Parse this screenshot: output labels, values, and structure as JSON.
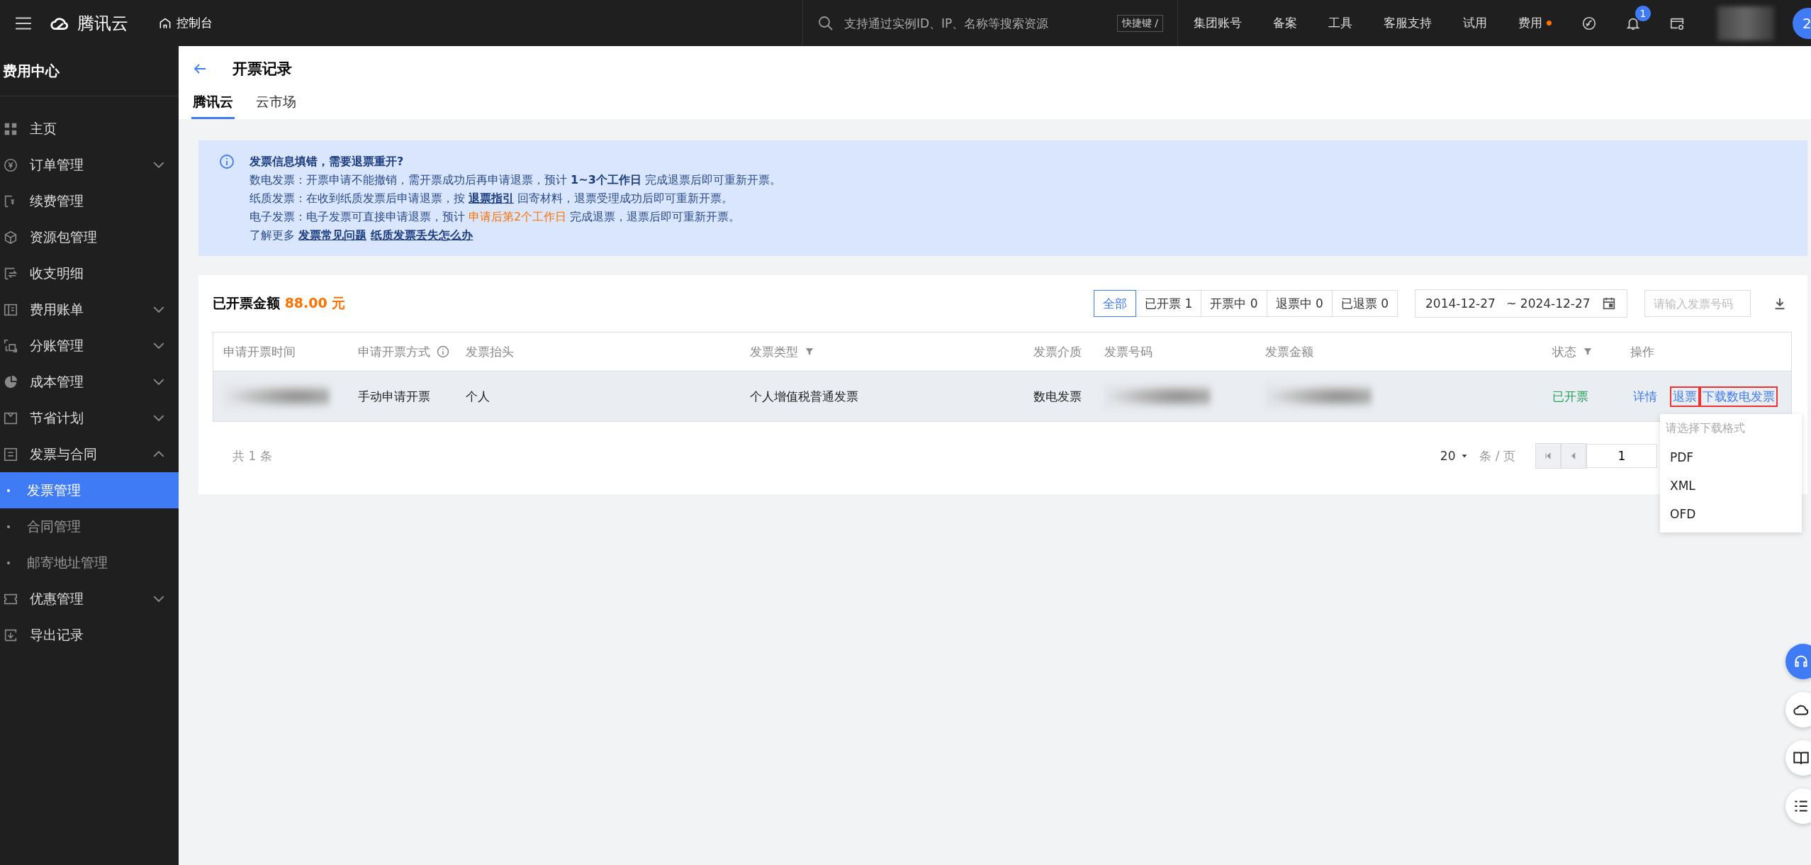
{
  "topbar": {
    "brand": "腾讯云",
    "console": "控制台",
    "search": {
      "placeholder": "支持通过实例ID、IP、名称等搜索资源",
      "shortcut": "快捷键 /"
    },
    "nav": [
      {
        "label": "集团账号",
        "dot": false
      },
      {
        "label": "备案",
        "dot": false
      },
      {
        "label": "工具",
        "dot": false
      },
      {
        "label": "客服支持",
        "dot": false
      },
      {
        "label": "试用",
        "dot": false
      },
      {
        "label": "费用",
        "dot": true
      }
    ],
    "bell_badge": "1",
    "user_badge": "2"
  },
  "sidebar": {
    "title": "费用中心",
    "items": [
      {
        "label": "主页"
      },
      {
        "label": "订单管理",
        "expanded": false
      },
      {
        "label": "续费管理"
      },
      {
        "label": "资源包管理"
      },
      {
        "label": "收支明细"
      },
      {
        "label": "费用账单",
        "expanded": false
      },
      {
        "label": "分账管理",
        "expanded": false
      },
      {
        "label": "成本管理",
        "expanded": false
      },
      {
        "label": "节省计划",
        "expanded": false
      },
      {
        "label": "发票与合同",
        "expanded": true,
        "children": [
          {
            "label": "发票管理",
            "selected": true
          },
          {
            "label": "合同管理",
            "selected": false
          },
          {
            "label": "邮寄地址管理",
            "selected": false
          }
        ]
      },
      {
        "label": "优惠管理",
        "expanded": false
      },
      {
        "label": "导出记录"
      }
    ]
  },
  "page": {
    "title": "开票记录",
    "tabs": [
      {
        "label": "腾讯云",
        "selected": true
      },
      {
        "label": "云市场",
        "selected": false
      }
    ]
  },
  "notice": {
    "title": "发票信息填错，需要退票重开?",
    "lines": [
      [
        {
          "kind": "plain",
          "text": "数电发票：开票申请不能撤销，需开票成功后再申请退票，预计 "
        },
        {
          "kind": "bold",
          "text": "1~3个工作日"
        },
        {
          "kind": "plain",
          "text": " 完成退票后即可重新开票。"
        }
      ],
      [
        {
          "kind": "plain",
          "text": "纸质发票：在收到纸质发票后申请退票，按 "
        },
        {
          "kind": "link",
          "text": "退票指引"
        },
        {
          "kind": "plain",
          "text": " 回寄材料，退票受理成功后即可重新开票。"
        }
      ],
      [
        {
          "kind": "plain",
          "text": "电子发票：电子发票可直接申请退票，预计 "
        },
        {
          "kind": "highlight",
          "text": "申请后第2个工作日"
        },
        {
          "kind": "plain",
          "text": " 完成退票，退票后即可重新开票。"
        }
      ],
      [
        {
          "kind": "plain",
          "text": "了解更多 "
        },
        {
          "kind": "link",
          "text": "发票常见问题"
        },
        {
          "kind": "link",
          "text": "纸质发票丢失怎么办"
        }
      ]
    ]
  },
  "summary": {
    "label": "已开票金额",
    "amount": "88.00 元"
  },
  "filters": [
    {
      "label": "全部",
      "selected": true
    },
    {
      "label": "已开票 1",
      "selected": false
    },
    {
      "label": "开票中 0",
      "selected": false
    },
    {
      "label": "退票中 0",
      "selected": false
    },
    {
      "label": "已退票 0",
      "selected": false
    }
  ],
  "date_range": {
    "start": "2014-12-27",
    "end": "~ 2024-12-27"
  },
  "invoice_search": {
    "placeholder": "请输入发票号码"
  },
  "table": {
    "columns": [
      {
        "label": "申请开票时间",
        "kind": "plain"
      },
      {
        "label": "申请开票方式",
        "kind": "info"
      },
      {
        "label": "发票抬头",
        "kind": "plain"
      },
      {
        "label": "发票类型",
        "kind": "filter"
      },
      {
        "label": "发票介质",
        "kind": "plain"
      },
      {
        "label": "发票号码",
        "kind": "plain"
      },
      {
        "label": "发票金额",
        "kind": "plain"
      },
      {
        "label": "状态",
        "kind": "filter"
      },
      {
        "label": "操作",
        "kind": "plain"
      }
    ],
    "rows": [
      {
        "cells": [
          {
            "kind": "blurred"
          },
          {
            "kind": "text",
            "text": "手动申请开票"
          },
          {
            "kind": "text",
            "text": "个人"
          },
          {
            "kind": "text",
            "text": "个人增值税普通发票"
          },
          {
            "kind": "text",
            "text": "数电发票"
          },
          {
            "kind": "blurred"
          },
          {
            "kind": "blurred"
          },
          {
            "kind": "status",
            "text": "已开票"
          },
          {
            "kind": "actions",
            "actions": [
              {
                "label": "详情",
                "highlighted": false
              },
              {
                "label": "退票",
                "highlighted": true
              },
              {
                "label": "下载数电发票",
                "highlighted": true
              }
            ]
          }
        ]
      }
    ]
  },
  "pagination": {
    "total": "共 1 条",
    "page_size": "20",
    "per_page": "条 / 页",
    "page": "1"
  },
  "download_menu": {
    "title": "请选择下载格式",
    "options": [
      "PDF",
      "XML",
      "OFD"
    ]
  }
}
